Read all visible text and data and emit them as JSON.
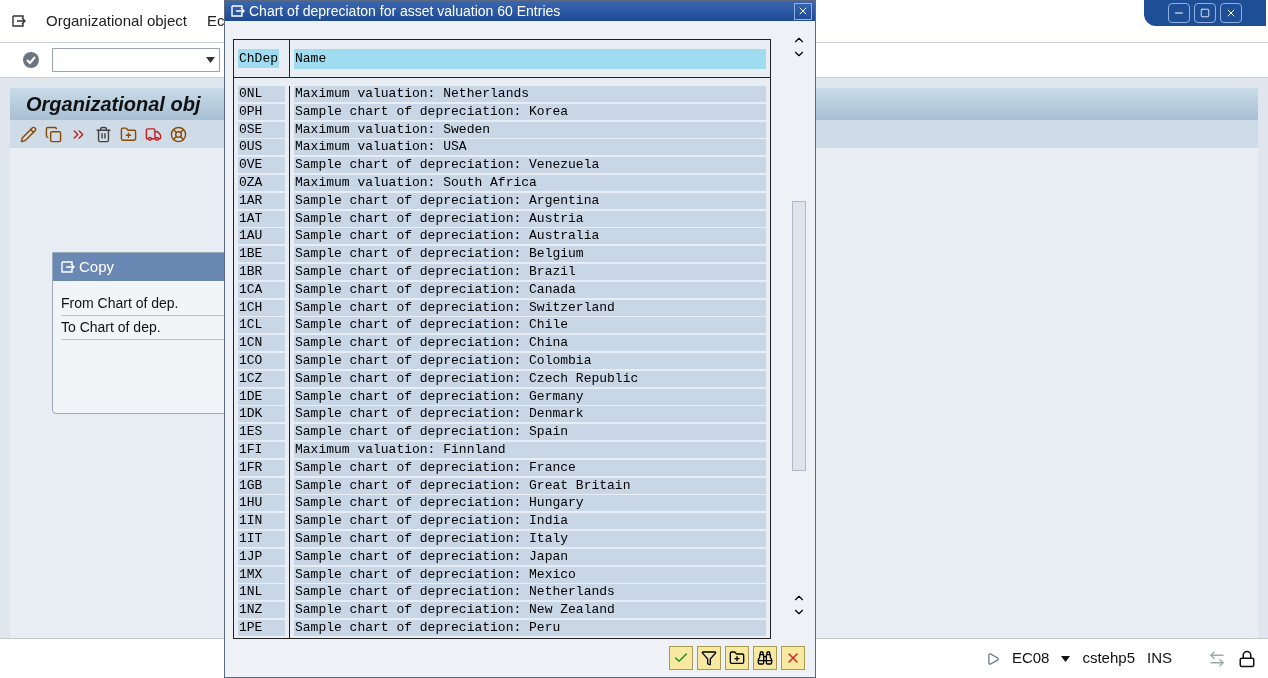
{
  "menu_bar": {
    "items": [
      "Organizational object",
      "Ec"
    ]
  },
  "page_title": "Organizational obj",
  "copy_panel": {
    "title": "Copy",
    "fields": [
      "From Chart of dep.",
      "To Chart of dep."
    ]
  },
  "dialog": {
    "title": "Chart of depreciaton for asset valuation 60 Entries",
    "columns": [
      "ChDep",
      "Name"
    ],
    "rows": [
      [
        "0NL",
        "Maximum valuation: Netherlands"
      ],
      [
        "0PH",
        "Sample chart of depreciation: Korea"
      ],
      [
        "0SE",
        "Maximum valuation: Sweden"
      ],
      [
        "0US",
        "Maximum valuation: USA"
      ],
      [
        "0VE",
        "Sample chart of depreciation: Venezuela"
      ],
      [
        "0ZA",
        "Maximum valuation: South Africa"
      ],
      [
        "1AR",
        "Sample chart of depreciation: Argentina"
      ],
      [
        "1AT",
        "Sample chart of depreciation: Austria"
      ],
      [
        "1AU",
        "Sample chart of depreciation: Australia"
      ],
      [
        "1BE",
        "Sample chart of depreciation: Belgium"
      ],
      [
        "1BR",
        "Sample chart of depreciation: Brazil"
      ],
      [
        "1CA",
        "Sample chart of depreciation: Canada"
      ],
      [
        "1CH",
        "Sample chart of depreciation: Switzerland"
      ],
      [
        "1CL",
        "Sample chart of depreciation: Chile"
      ],
      [
        "1CN",
        "Sample chart of depreciation: China"
      ],
      [
        "1CO",
        "Sample chart of depreciation: Colombia"
      ],
      [
        "1CZ",
        "Sample chart of depreciation: Czech Republic"
      ],
      [
        "1DE",
        "Sample chart of depreciation: Germany"
      ],
      [
        "1DK",
        "Sample chart of depreciation: Denmark"
      ],
      [
        "1ES",
        "Sample chart of depreciation: Spain"
      ],
      [
        "1FI",
        "Maximum valuation: Finnland"
      ],
      [
        "1FR",
        "Sample chart of depreciation: France"
      ],
      [
        "1GB",
        "Sample chart of depreciation: Great Britain"
      ],
      [
        "1HU",
        "Sample chart of depreciation: Hungary"
      ],
      [
        "1IN",
        "Sample chart of depreciation: India"
      ],
      [
        "1IT",
        "Sample chart of depreciation: Italy"
      ],
      [
        "1JP",
        "Sample chart of depreciation: Japan"
      ],
      [
        "1MX",
        "Sample chart of depreciation: Mexico"
      ],
      [
        "1NL",
        "Sample chart of depreciation: Netherlands"
      ],
      [
        "1NZ",
        "Sample chart of depreciation: New Zealand"
      ],
      [
        "1PE",
        "Sample chart of depreciation: Peru"
      ]
    ]
  },
  "status_bar": {
    "system": "EC08",
    "server": "cstehp5",
    "mode": "INS"
  }
}
